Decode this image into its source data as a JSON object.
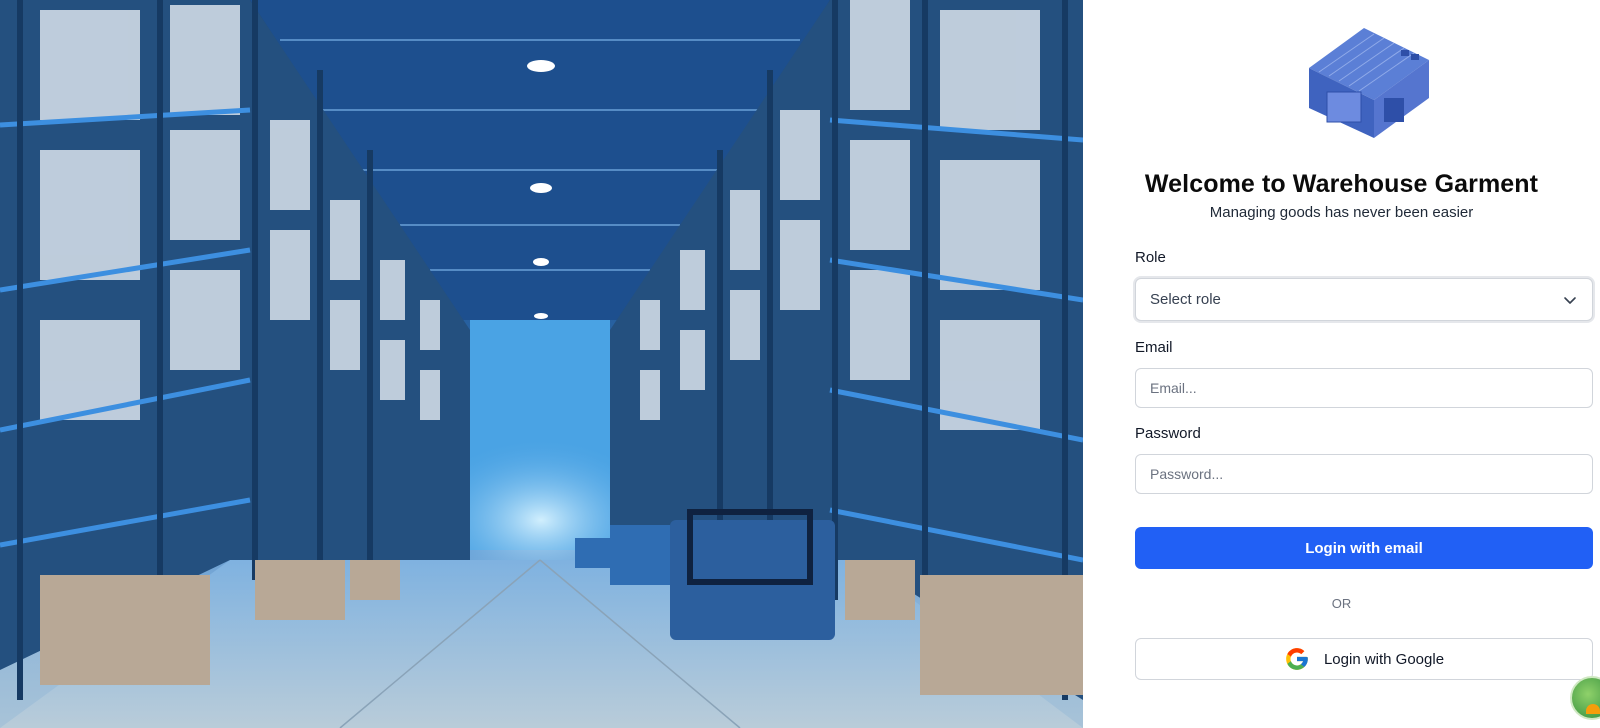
{
  "app": {
    "title": "Welcome to Warehouse Garment",
    "subtitle": "Managing goods has never been easier"
  },
  "hero": {
    "icon": "warehouse-illustration",
    "accent": "#2f6fb3"
  },
  "logo": {
    "icon": "warehouse-building-icon",
    "color": "#4a6fd1"
  },
  "form": {
    "role": {
      "label": "Role",
      "selected": "Select role",
      "icon": "chevron-down-icon"
    },
    "email": {
      "label": "Email",
      "placeholder": "Email..."
    },
    "password": {
      "label": "Password",
      "placeholder": "Password..."
    },
    "login_email_label": "Login with email",
    "or_label": "OR",
    "login_google_label": "Login with Google"
  },
  "colors": {
    "primary": "#2160f5",
    "text": "#111827",
    "muted": "#6b7280",
    "border": "#d1d5db"
  }
}
